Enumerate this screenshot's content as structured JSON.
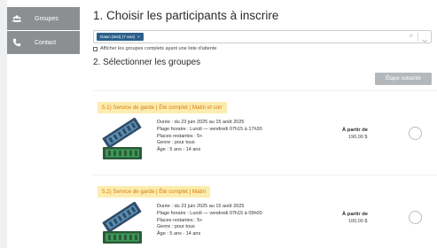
{
  "sidebar": {
    "items": [
      {
        "label": "Groupes",
        "icon": "group-icon"
      },
      {
        "label": "Contact",
        "icon": "phone-icon"
      }
    ]
  },
  "main": {
    "step1_title": "1. Choisir les participants à inscrire",
    "participant_chip": "Dawn (test) (7 ans)",
    "chip_remove": "×",
    "clear_symbol": "×",
    "show_full_label": "Afficher les groupes complets ayant une liste d'attente",
    "step2_title": "2. Sélectionner les groupes",
    "next_button": "Étape suivante"
  },
  "groups": [
    {
      "title": "5.1) Service de garde | Été complet | Matin et soir",
      "duree": "Durée : du 23 juin 2025 au 15 août 2025",
      "plage": "Plage horaire : Lundi — vendredi 07h15 à 17h30",
      "places": "Places restantes : 5+",
      "genre": "Genre : pour tous",
      "age": "Âge : 5 ans - 14 ans",
      "price_label": "À partir de",
      "price": "190,00 $"
    },
    {
      "title": "5.2) Service de garde | Été complet | Matin",
      "duree": "Durée : du 23 juin 2025 au 15 août 2025",
      "plage": "Plage horaire : Lundi — vendredi 07h15 à 09h00",
      "places": "Places restantes : 5+",
      "genre": "Genre : pour tous",
      "age": "Âge : 5 ans - 14 ans",
      "price_label": "À partir de",
      "price": "100,00 $"
    }
  ],
  "colors": {
    "sidebar_bg": "#8c8f92",
    "chip_bg": "#2b5f8a",
    "title_highlight": "#fcecae",
    "title_text": "#d77c14",
    "button_disabled": "#b5b8bb",
    "ticket_dark": "#2f4b68",
    "ticket_green": "#3e9a56"
  }
}
